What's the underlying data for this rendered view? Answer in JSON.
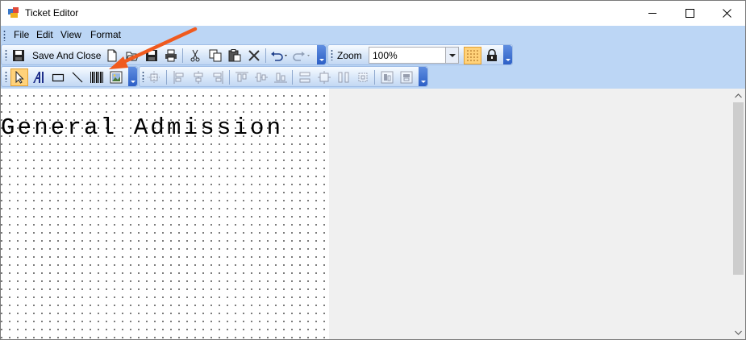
{
  "window": {
    "title": "Ticket Editor"
  },
  "menu": {
    "items": [
      {
        "label": "File"
      },
      {
        "label": "Edit"
      },
      {
        "label": "View"
      },
      {
        "label": "Format"
      }
    ]
  },
  "toolbar": {
    "save_close_label": "Save And Close",
    "zoom_label": "Zoom",
    "zoom_value": "100%"
  },
  "ticket": {
    "text": "General Admission"
  },
  "colors": {
    "toolbar_bg": "#bcd6f5",
    "overflow_button": "#2d5fc6",
    "selected_tool": "#ffd27a",
    "annotation_arrow": "#f05a1e"
  },
  "icons": {
    "title": [
      "app-icon",
      "minimize-icon",
      "maximize-icon",
      "close-icon"
    ],
    "standard_toolbar": [
      "save-icon",
      "new-icon",
      "open-icon",
      "save-icon",
      "print-icon",
      "cut-icon",
      "copy-icon",
      "paste-icon",
      "delete-icon",
      "undo-icon",
      "redo-icon",
      "grid-icon",
      "lock-icon"
    ],
    "tools_toolbar": [
      "pointer-icon",
      "text-icon",
      "rectangle-icon",
      "line-icon",
      "barcode-icon",
      "image-icon"
    ],
    "layout_toolbar": [
      "align-to-grid-icon",
      "align-left-icon",
      "align-center-icon",
      "align-right-icon",
      "align-top-icon",
      "align-middle-icon",
      "align-bottom-icon",
      "make-same-width-icon",
      "make-same-size-icon",
      "make-same-height-icon",
      "size-to-grid-icon",
      "bring-to-front-icon",
      "send-to-back-icon"
    ]
  },
  "annotation": {
    "type": "arrow",
    "points_to": "image-tool-button"
  }
}
